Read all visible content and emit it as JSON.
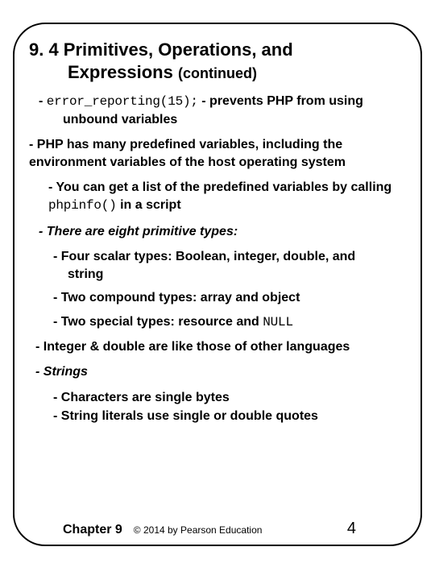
{
  "title_line1": "9. 4 Primitives, Operations, and",
  "title_line2": "Expressions",
  "title_cont": "(continued)",
  "bullets": {
    "b1_pre": "- ",
    "b1_code": "error_reporting(15);",
    "b1_post": " - prevents PHP from using",
    "b1_line2": "unbound variables",
    "b2": "- PHP has many predefined variables, including the environment variables of the host operating system",
    "b3_part1": "- You can get a list of the predefined variables by calling ",
    "b3_code": "phpinfo()",
    "b3_part2": " in a script",
    "b4": "- There are eight primitive types:",
    "b5_line1": "- Four scalar types: Boolean, integer, double, and",
    "b5_line2": "string",
    "b6": "- Two compound types: array and object",
    "b7_part1": "- Two special types: resource and ",
    "b7_code": "NULL",
    "b8": "- Integer & double are like those of other languages",
    "b9": "- Strings",
    "b10": "- Characters are single bytes",
    "b11": "- String literals use single or double quotes"
  },
  "footer": {
    "chapter": "Chapter 9",
    "copyright": "© 2014 by Pearson Education",
    "page": "4"
  }
}
